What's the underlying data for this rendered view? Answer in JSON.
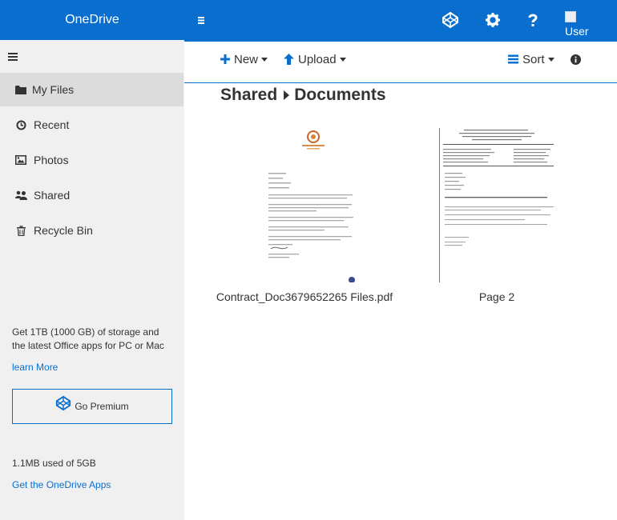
{
  "header": {
    "brand": "OneDrive",
    "avatar_alt": "User"
  },
  "sidebar": {
    "items": [
      {
        "label": "My Files",
        "icon": "folder-icon",
        "active": true
      },
      {
        "label": "Recent",
        "icon": "clock-icon",
        "active": false
      },
      {
        "label": "Photos",
        "icon": "image-icon",
        "active": false
      },
      {
        "label": "Shared",
        "icon": "users-icon",
        "active": false
      },
      {
        "label": "Recycle Bin",
        "icon": "trash-icon",
        "active": false
      }
    ],
    "promo_text": "Get 1TB (1000 GB) of storage and the latest Office apps for PC or Mac",
    "learn_more": "learn More",
    "premium_label": "Go Premium",
    "usage": "1.1MB used of 5GB",
    "get_apps": "Get the OneDrive Apps"
  },
  "commands": {
    "new_label": "New",
    "upload_label": "Upload",
    "sort_label": "Sort"
  },
  "breadcrumb": [
    "Shared",
    "Documents"
  ],
  "files": [
    {
      "name": "Contract_Doc3679652265 Files.pdf"
    },
    {
      "name": "Page 2"
    }
  ],
  "colors": {
    "accent": "#0a6ecf",
    "sidebar_bg": "#f0f0f0",
    "active_bg": "#dcdcdc"
  }
}
